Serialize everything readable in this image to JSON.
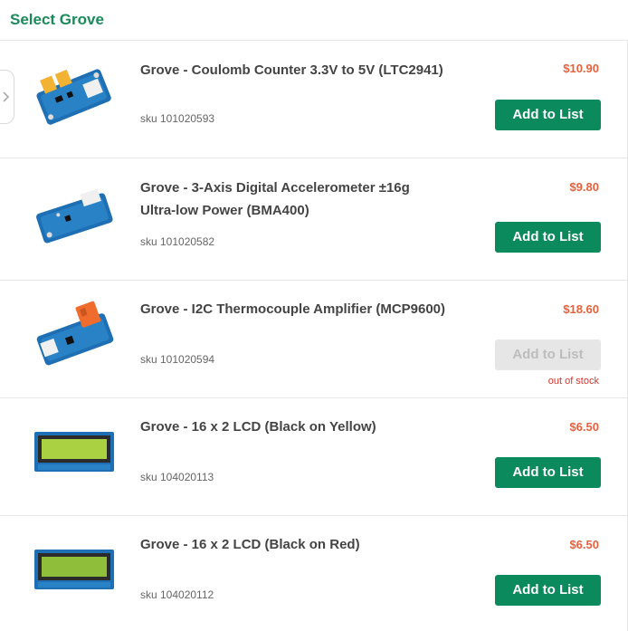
{
  "header": {
    "title": "Select Grove"
  },
  "products": [
    {
      "name": "Grove - Coulomb Counter 3.3V to 5V (LTC2941)",
      "sku": "sku 101020593",
      "price": "$10.90",
      "button": "Add to List",
      "status": ""
    },
    {
      "name": "Grove - 3-Axis Digital Accelerometer ±16g Ultra-low Power (BMA400)",
      "sku": "sku 101020582",
      "price": "$9.80",
      "button": "Add to List",
      "status": ""
    },
    {
      "name": "Grove - I2C Thermocouple Amplifier (MCP9600)",
      "sku": "sku 101020594",
      "price": "$18.60",
      "button": "Add to List",
      "status": "out of stock"
    },
    {
      "name": "Grove - 16 x 2 LCD (Black on Yellow)",
      "sku": "sku 104020113",
      "price": "$6.50",
      "button": "Add to List",
      "status": ""
    },
    {
      "name": "Grove - 16 x 2 LCD (Black on Red)",
      "sku": "sku 104020112",
      "price": "$6.50",
      "button": "Add to List",
      "status": ""
    }
  ],
  "colors": {
    "brand": "#1a8a5a",
    "button": "#0b8a5e",
    "price": "#e8613c",
    "out_of_stock": "#d9342b"
  },
  "icons": {
    "side_tab": "chevron-right-icon"
  }
}
